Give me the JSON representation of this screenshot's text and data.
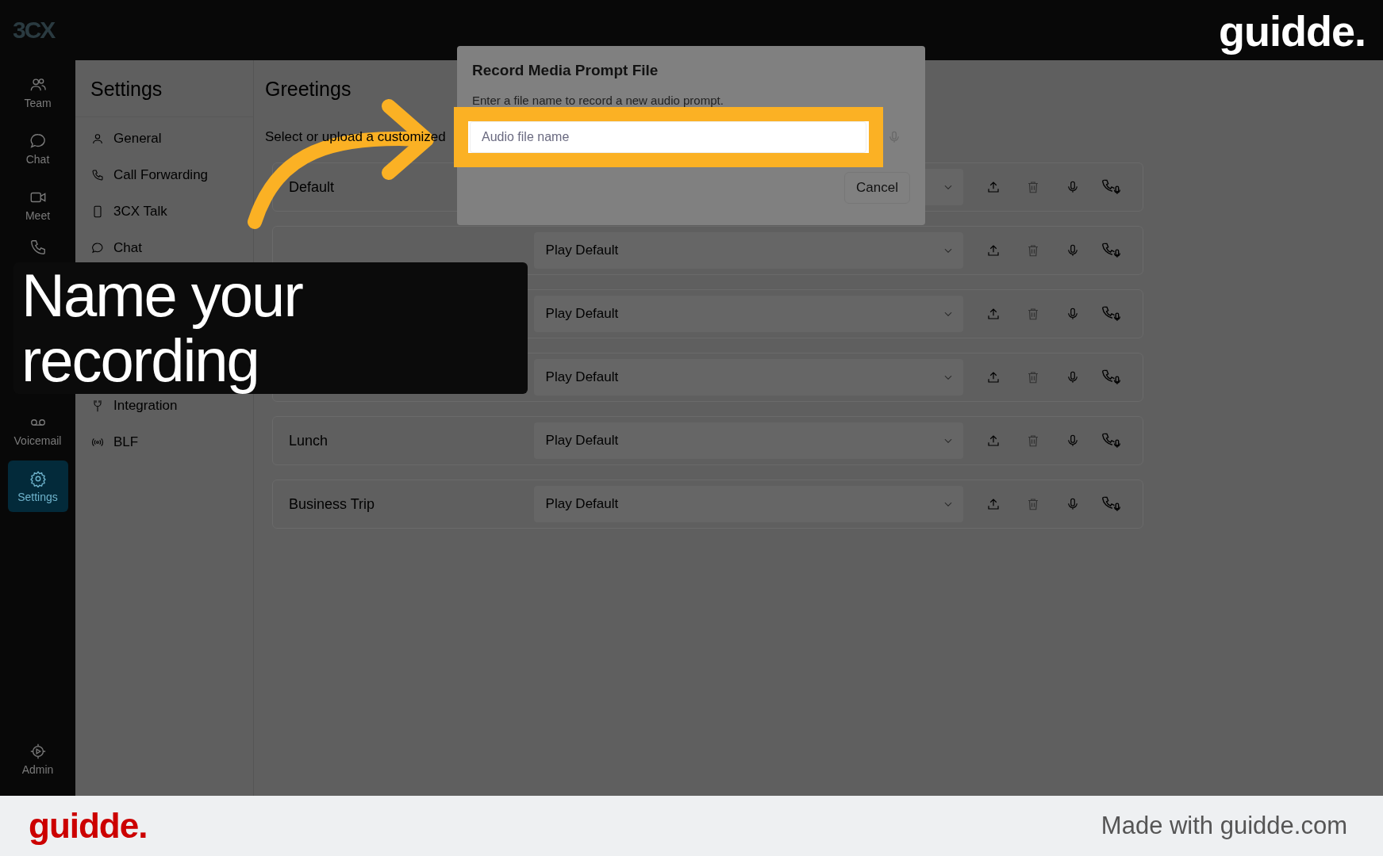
{
  "header": {
    "logo": "3CX"
  },
  "rail": {
    "items": [
      {
        "label": "Team",
        "selected": false
      },
      {
        "label": "Chat",
        "selected": false
      },
      {
        "label": "Meet",
        "selected": false
      },
      {
        "selected": false
      },
      {
        "label": "Voicemail",
        "selected": false
      },
      {
        "label": "Settings",
        "selected": true
      }
    ],
    "admin": {
      "label": "Admin"
    }
  },
  "settings_menu": {
    "title": "Settings",
    "items": [
      {
        "label": "General",
        "selected": false
      },
      {
        "label": "Call Forwarding",
        "selected": false
      },
      {
        "label": "3CX Talk",
        "selected": false
      },
      {
        "label": "Chat",
        "selected": false
      },
      {
        "label": "Integration",
        "selected": false
      },
      {
        "label": "BLF",
        "selected": false
      }
    ]
  },
  "greetings": {
    "title": "Greetings",
    "subtitle": "Select or upload a customized",
    "rows": [
      {
        "name": "Default"
      },
      {
        "value": "Play Default"
      },
      {
        "value": "Play Default"
      },
      {
        "value": "Play Default"
      },
      {
        "name": "Lunch",
        "value": "Play Default"
      },
      {
        "name": "Business Trip",
        "value": "Play Default"
      }
    ]
  },
  "dialog": {
    "title": "Record Media Prompt File",
    "description": "Enter a file name to record a new audio prompt.",
    "field": {
      "placeholder": "Audio file name"
    },
    "buttons": [
      "Cancel"
    ]
  },
  "callout": {
    "text": "Name your recording"
  },
  "brand": {
    "top_logo": "guidde.",
    "footer_logo": "guidde.",
    "footer_text": "Made with guidde.com"
  }
}
